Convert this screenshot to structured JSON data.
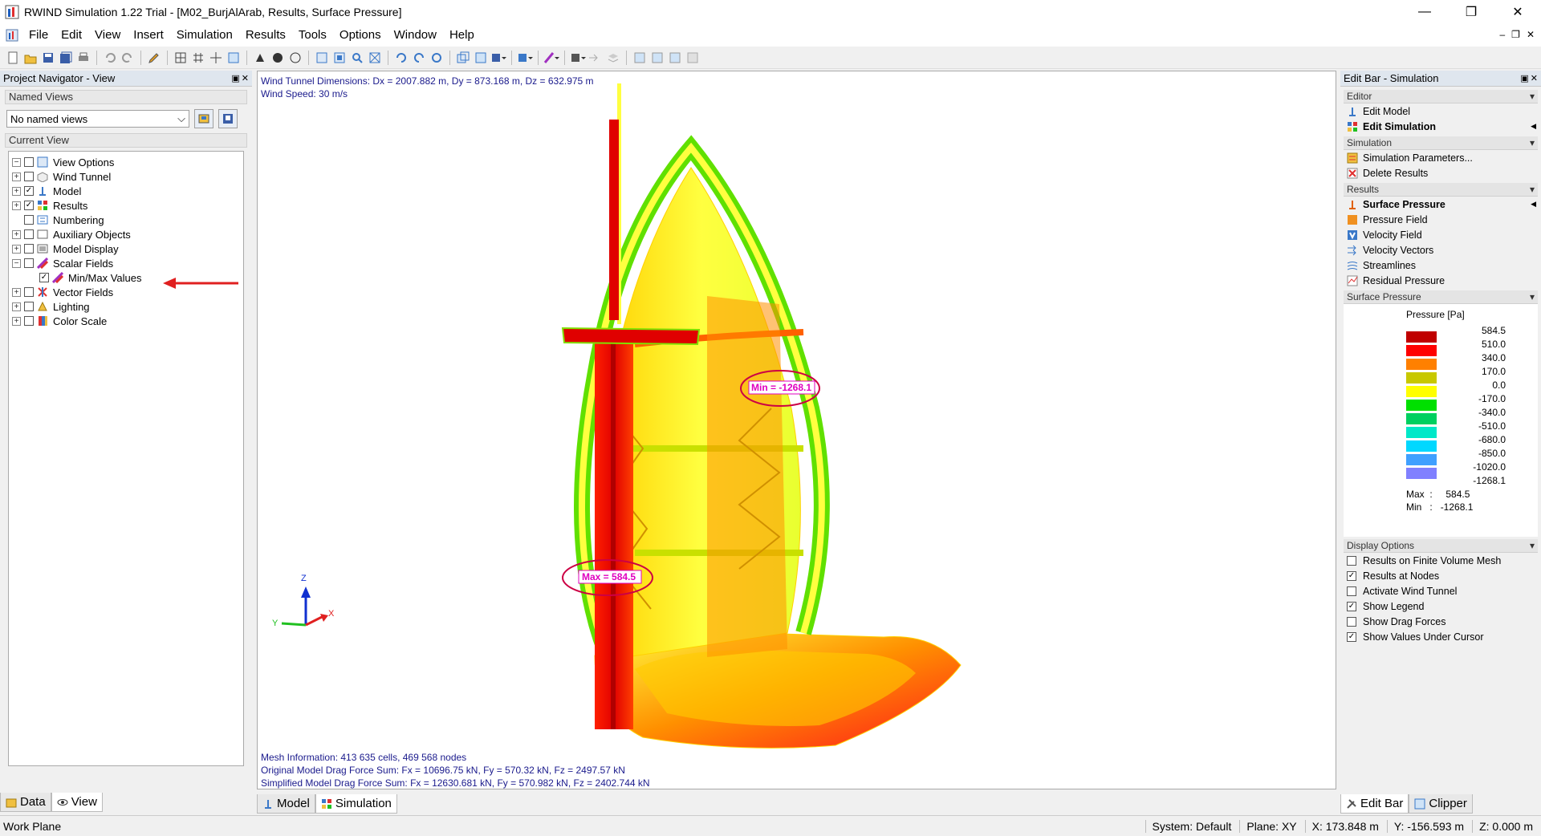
{
  "window": {
    "title": "RWIND Simulation 1.22 Trial - [M02_BurjAlArab, Results, Surface Pressure]"
  },
  "menu": [
    "File",
    "Edit",
    "View",
    "Insert",
    "Simulation",
    "Results",
    "Tools",
    "Options",
    "Window",
    "Help"
  ],
  "navigator": {
    "header": "Project Navigator - View",
    "named_views_title": "Named Views",
    "named_views_value": "No named views",
    "current_view_title": "Current View",
    "tree": [
      {
        "label": "View Options",
        "checked": false,
        "expander": "minus",
        "icon": "view-options-icon"
      },
      {
        "label": "Wind Tunnel",
        "checked": false,
        "expander": "plus",
        "icon": "wind-tunnel-icon"
      },
      {
        "label": "Model",
        "checked": true,
        "expander": "plus",
        "icon": "model-icon"
      },
      {
        "label": "Results",
        "checked": true,
        "expander": "plus",
        "icon": "results-icon"
      },
      {
        "label": "Numbering",
        "checked": false,
        "expander": "none",
        "icon": "numbering-icon"
      },
      {
        "label": "Auxiliary Objects",
        "checked": false,
        "expander": "plus",
        "icon": "auxiliary-objects-icon"
      },
      {
        "label": "Model Display",
        "checked": false,
        "expander": "plus",
        "icon": "model-display-icon"
      },
      {
        "label": "Scalar Fields",
        "checked": false,
        "expander": "minus",
        "icon": "scalar-fields-icon"
      },
      {
        "label": "Min/Max Values",
        "checked": true,
        "expander": "child",
        "icon": "min-max-icon"
      },
      {
        "label": "Vector Fields",
        "checked": false,
        "expander": "plus",
        "icon": "vector-fields-icon"
      },
      {
        "label": "Lighting",
        "checked": false,
        "expander": "plus",
        "icon": "lighting-icon"
      },
      {
        "label": "Color Scale",
        "checked": false,
        "expander": "plus",
        "icon": "color-scale-icon"
      }
    ],
    "tabs": {
      "data": "Data",
      "view": "View"
    }
  },
  "viewport": {
    "dimensions": "Wind Tunnel Dimensions: Dx = 2007.882 m, Dy = 873.168 m, Dz = 632.975 m",
    "wind_speed": "Wind Speed: 30 m/s",
    "mesh_info": "Mesh Information: 413 635 cells, 469 568 nodes",
    "original_drag": "Original Model Drag Force Sum: Fx = 10696.75 kN, Fy = 570.32 kN, Fz = 2497.57 kN",
    "simplified_drag": "Simplified Model Drag Force Sum: Fx = 12630.681 kN, Fy = 570.982 kN, Fz = 2402.744 kN",
    "min_label": "Min = -1268.1",
    "max_label": "Max = 584.5",
    "axes": {
      "z": "Z",
      "y": "Y",
      "x": "X"
    },
    "tabs": {
      "model": "Model",
      "simulation": "Simulation"
    }
  },
  "editbar": {
    "header": "Edit Bar - Simulation",
    "editor_title": "Editor",
    "editor_items": [
      {
        "label": "Edit Model",
        "bold": false,
        "icon": "edit-model-icon"
      },
      {
        "label": "Edit Simulation",
        "bold": true,
        "icon": "edit-simulation-icon"
      }
    ],
    "simulation_title": "Simulation",
    "simulation_items": [
      {
        "label": "Simulation Parameters...",
        "icon": "simulation-parameters-icon"
      },
      {
        "label": "Delete Results",
        "icon": "delete-results-icon"
      }
    ],
    "results_title": "Results",
    "results_items": [
      {
        "label": "Surface Pressure",
        "bold": true,
        "icon": "surface-pressure-icon"
      },
      {
        "label": "Pressure Field",
        "bold": false,
        "icon": "pressure-field-icon"
      },
      {
        "label": "Velocity Field",
        "bold": false,
        "icon": "velocity-field-icon"
      },
      {
        "label": "Velocity Vectors",
        "bold": false,
        "icon": "velocity-vectors-icon"
      },
      {
        "label": "Streamlines",
        "bold": false,
        "icon": "streamlines-icon"
      },
      {
        "label": "Residual Pressure",
        "bold": false,
        "icon": "residual-pressure-icon"
      }
    ],
    "surface_pressure_title": "Surface Pressure",
    "legend_title": "Pressure [Pa]",
    "legend": [
      {
        "value": "584.5",
        "color": "#c00000"
      },
      {
        "value": "510.0",
        "color": "#ff0000"
      },
      {
        "value": "340.0",
        "color": "#ff8000"
      },
      {
        "value": "170.0",
        "color": "#c8c800"
      },
      {
        "value": "0.0",
        "color": "#ffff00"
      },
      {
        "value": "-170.0",
        "color": "#00e000"
      },
      {
        "value": "-340.0",
        "color": "#00d060"
      },
      {
        "value": "-510.0",
        "color": "#00e8c8"
      },
      {
        "value": "-680.0",
        "color": "#00d8ff"
      },
      {
        "value": "-850.0",
        "color": "#40a0ff"
      },
      {
        "value": "-1020.0",
        "color": "#8080ff"
      },
      {
        "value": "-1268.1",
        "color": "#0000e0"
      }
    ],
    "max": {
      "label": "Max",
      "value": "584.5"
    },
    "min": {
      "label": "Min",
      "value": "-1268.1"
    },
    "display_options_title": "Display Options",
    "display_options": [
      {
        "label": "Results on Finite Volume Mesh",
        "checked": false
      },
      {
        "label": "Results at Nodes",
        "checked": true
      },
      {
        "label": "Activate Wind Tunnel",
        "checked": false
      },
      {
        "label": "Show Legend",
        "checked": true
      },
      {
        "label": "Show Drag Forces",
        "checked": false
      },
      {
        "label": "Show Values Under Cursor",
        "checked": true
      }
    ],
    "tabs": {
      "edit_bar": "Edit Bar",
      "clipper": "Clipper"
    }
  },
  "status": {
    "left": "Work Plane",
    "system": "System: Default",
    "plane": "Plane: XY",
    "x": "X:  173.848 m",
    "y": "Y:  -156.593 m",
    "z": "Z:  0.000 m"
  },
  "colors": {
    "info_text": "#1a1a8c",
    "annotation": "#cc0044",
    "minmax_text": "#e000c0"
  }
}
